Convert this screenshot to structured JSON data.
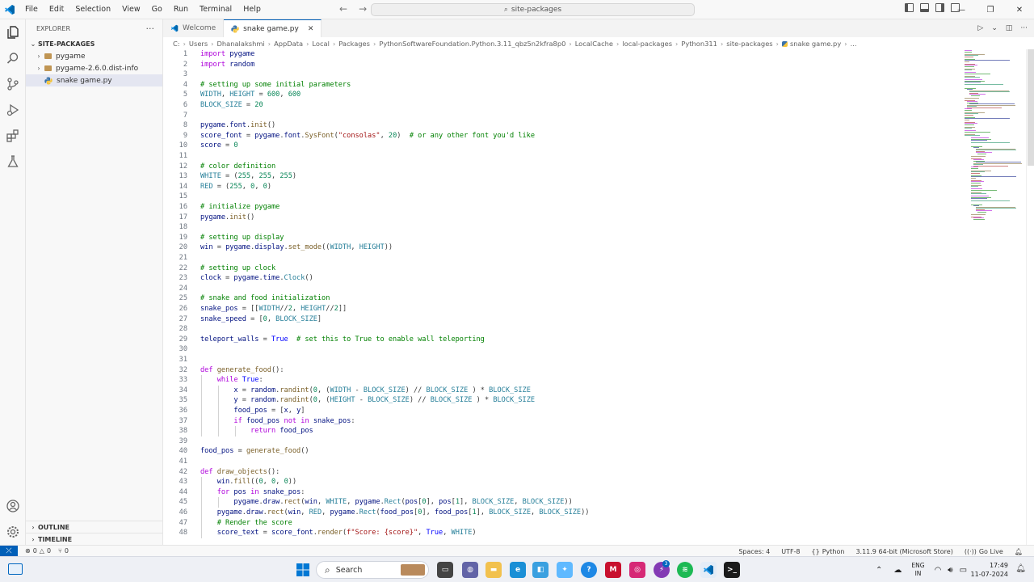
{
  "titlebar": {
    "menus": [
      "File",
      "Edit",
      "Selection",
      "View",
      "Go",
      "Run",
      "Terminal",
      "Help"
    ],
    "search_text": "site-packages"
  },
  "sidebar": {
    "header": "EXPLORER",
    "section": "SITE-PACKAGES",
    "items": [
      {
        "label": "pygame",
        "type": "folder"
      },
      {
        "label": "pygame-2.6.0.dist-info",
        "type": "folder"
      },
      {
        "label": "snake game.py",
        "type": "python"
      }
    ],
    "outline": "OUTLINE",
    "timeline": "TIMELINE"
  },
  "tabs": [
    {
      "label": "Welcome",
      "active": false
    },
    {
      "label": "snake game.py",
      "active": true
    }
  ],
  "breadcrumb": [
    "C:",
    "Users",
    "Dhanalakshmi",
    "AppData",
    "Local",
    "Packages",
    "PythonSoftwareFoundation.Python.3.11_qbz5n2kfra8p0",
    "LocalCache",
    "local-packages",
    "Python311",
    "site-packages",
    "snake game.py",
    "..."
  ],
  "code": [
    {
      "n": 1,
      "t": "import pygame"
    },
    {
      "n": 2,
      "t": "import random"
    },
    {
      "n": 3,
      "t": ""
    },
    {
      "n": 4,
      "t": "# setting up some initial parameters"
    },
    {
      "n": 5,
      "t": "WIDTH, HEIGHT = 600, 600"
    },
    {
      "n": 6,
      "t": "BLOCK_SIZE = 20"
    },
    {
      "n": 7,
      "t": ""
    },
    {
      "n": 8,
      "t": "pygame.font.init()"
    },
    {
      "n": 9,
      "t": "score_font = pygame.font.SysFont(\"consolas\", 20)  # or any other font you'd like"
    },
    {
      "n": 10,
      "t": "score = 0"
    },
    {
      "n": 11,
      "t": ""
    },
    {
      "n": 12,
      "t": "# color definition"
    },
    {
      "n": 13,
      "t": "WHITE = (255, 255, 255)"
    },
    {
      "n": 14,
      "t": "RED = (255, 0, 0)"
    },
    {
      "n": 15,
      "t": ""
    },
    {
      "n": 16,
      "t": "# initialize pygame"
    },
    {
      "n": 17,
      "t": "pygame.init()"
    },
    {
      "n": 18,
      "t": ""
    },
    {
      "n": 19,
      "t": "# setting up display"
    },
    {
      "n": 20,
      "t": "win = pygame.display.set_mode((WIDTH, HEIGHT))"
    },
    {
      "n": 21,
      "t": ""
    },
    {
      "n": 22,
      "t": "# setting up clock"
    },
    {
      "n": 23,
      "t": "clock = pygame.time.Clock()"
    },
    {
      "n": 24,
      "t": ""
    },
    {
      "n": 25,
      "t": "# snake and food initialization"
    },
    {
      "n": 26,
      "t": "snake_pos = [[WIDTH//2, HEIGHT//2]]"
    },
    {
      "n": 27,
      "t": "snake_speed = [0, BLOCK_SIZE]"
    },
    {
      "n": 28,
      "t": ""
    },
    {
      "n": 29,
      "t": "teleport_walls = True  # set this to True to enable wall teleporting"
    },
    {
      "n": 30,
      "t": ""
    },
    {
      "n": 31,
      "t": ""
    },
    {
      "n": 32,
      "t": "def generate_food():"
    },
    {
      "n": 33,
      "t": "    while True:"
    },
    {
      "n": 34,
      "t": "        x = random.randint(0, (WIDTH - BLOCK_SIZE) // BLOCK_SIZE ) * BLOCK_SIZE"
    },
    {
      "n": 35,
      "t": "        y = random.randint(0, (HEIGHT - BLOCK_SIZE) // BLOCK_SIZE ) * BLOCK_SIZE"
    },
    {
      "n": 36,
      "t": "        food_pos = [x, y]"
    },
    {
      "n": 37,
      "t": "        if food_pos not in snake_pos:"
    },
    {
      "n": 38,
      "t": "            return food_pos"
    },
    {
      "n": 39,
      "t": ""
    },
    {
      "n": 40,
      "t": "food_pos = generate_food()"
    },
    {
      "n": 41,
      "t": ""
    },
    {
      "n": 42,
      "t": "def draw_objects():"
    },
    {
      "n": 43,
      "t": "    win.fill((0, 0, 0))"
    },
    {
      "n": 44,
      "t": "    for pos in snake_pos:"
    },
    {
      "n": 45,
      "t": "        pygame.draw.rect(win, WHITE, pygame.Rect(pos[0], pos[1], BLOCK_SIZE, BLOCK_SIZE))"
    },
    {
      "n": 46,
      "t": "    pygame.draw.rect(win, RED, pygame.Rect(food_pos[0], food_pos[1], BLOCK_SIZE, BLOCK_SIZE))"
    },
    {
      "n": 47,
      "t": "    # Render the score"
    },
    {
      "n": 48,
      "t": "    score_text = score_font.render(f\"Score: {score}\", True, WHITE)"
    }
  ],
  "statusbar": {
    "errors": "0",
    "warnings": "0",
    "ports": "0",
    "spaces": "Spaces: 4",
    "encoding": "UTF-8",
    "language": "Python",
    "interpreter": "3.11.9 64-bit (Microsoft Store)",
    "golive": "Go Live"
  },
  "taskbar": {
    "search": "Search",
    "lang_top": "ENG",
    "lang_bottom": "IN",
    "time": "17:49",
    "date": "11-07-2024",
    "badge": "3"
  },
  "colors": {
    "accent": "#005fb8",
    "keyword": "#af00db",
    "comment": "#008000",
    "number": "#098658",
    "string": "#a31515",
    "function": "#795e26"
  }
}
